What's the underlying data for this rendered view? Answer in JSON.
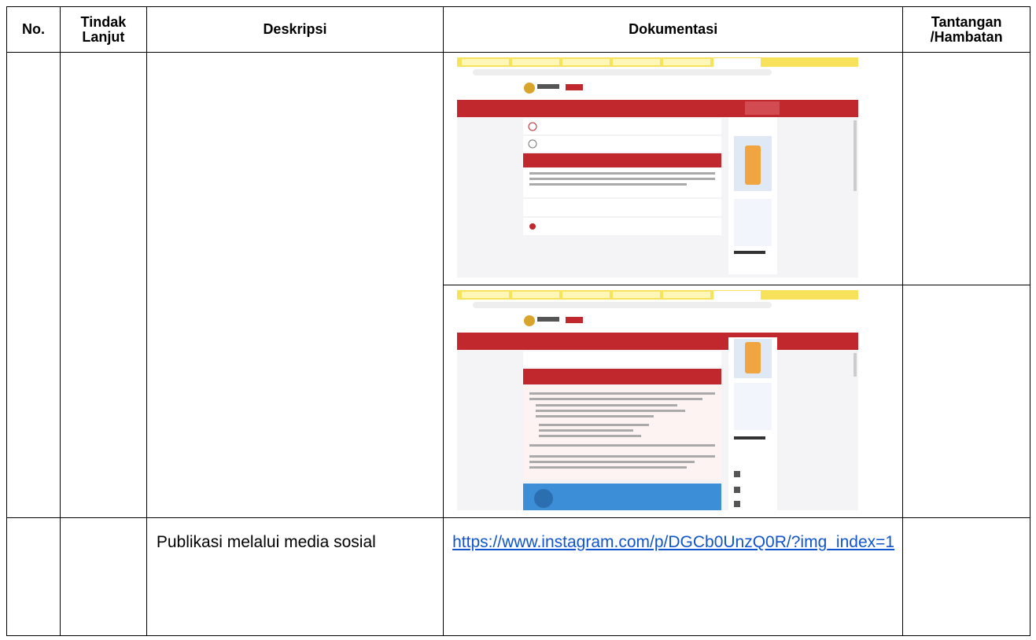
{
  "table": {
    "headers": {
      "no": "No.",
      "tindak_lanjut": "Tindak Lanjut",
      "deskripsi": "Deskripsi",
      "dokumentasi": "Dokumentasi",
      "tantangan": "Tantangan /Hambatan"
    },
    "rows": [
      {
        "no": "",
        "tindak_lanjut": "",
        "deskripsi": "",
        "dokumentasi": "screenshot-1",
        "tantangan": ""
      },
      {
        "no": "",
        "tindak_lanjut": "",
        "deskripsi": "",
        "dokumentasi": "screenshot-2",
        "tantangan": ""
      },
      {
        "no": "",
        "tindak_lanjut": "",
        "deskripsi": "Publikasi melalui media sosial",
        "dokumentasi_link": "https://www.instagram.com/p/DGCb0UnzQ0R/?img_index=1",
        "tantangan": ""
      }
    ]
  },
  "colors": {
    "browser_bar": "#f7e35b",
    "site_header": "#c0282e",
    "link": "#1155cc"
  }
}
